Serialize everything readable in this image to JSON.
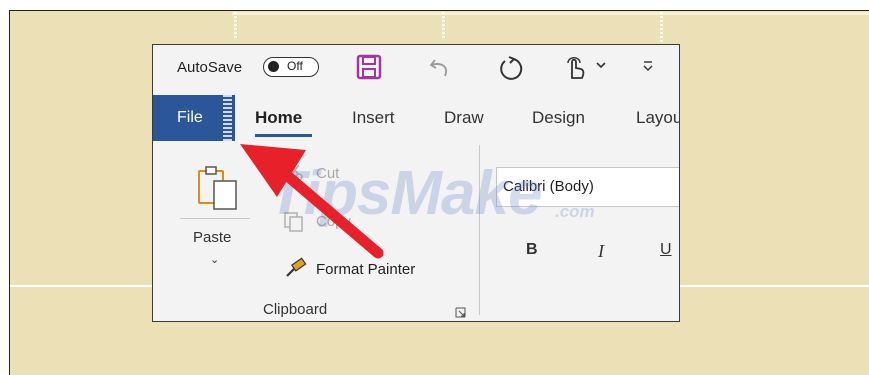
{
  "quick_access": {
    "autosave_label": "AutoSave",
    "autosave_state": "Off",
    "icons": [
      "save-icon",
      "undo-icon",
      "redo-icon",
      "touch-mode-icon",
      "customize-qat-icon"
    ]
  },
  "tabs": [
    "File",
    "Home",
    "Insert",
    "Draw",
    "Design",
    "Layou"
  ],
  "active_tab": "Home",
  "clipboard": {
    "paste_label": "Paste",
    "cut_label": "Cut",
    "copy_label": "Copy",
    "format_painter_label": "Format Painter",
    "group_label": "Clipboard"
  },
  "font": {
    "font_name": "Calibri (Body)",
    "bold_label": "B",
    "italic_label": "I",
    "underline_label": "U"
  },
  "watermark": {
    "main": "TipsMake",
    "suffix": ".com"
  },
  "colors": {
    "file_tab_bg": "#2b579a",
    "arrow": "#e8202a",
    "save_icon": "#a4379e",
    "background": "#ece1b6"
  }
}
